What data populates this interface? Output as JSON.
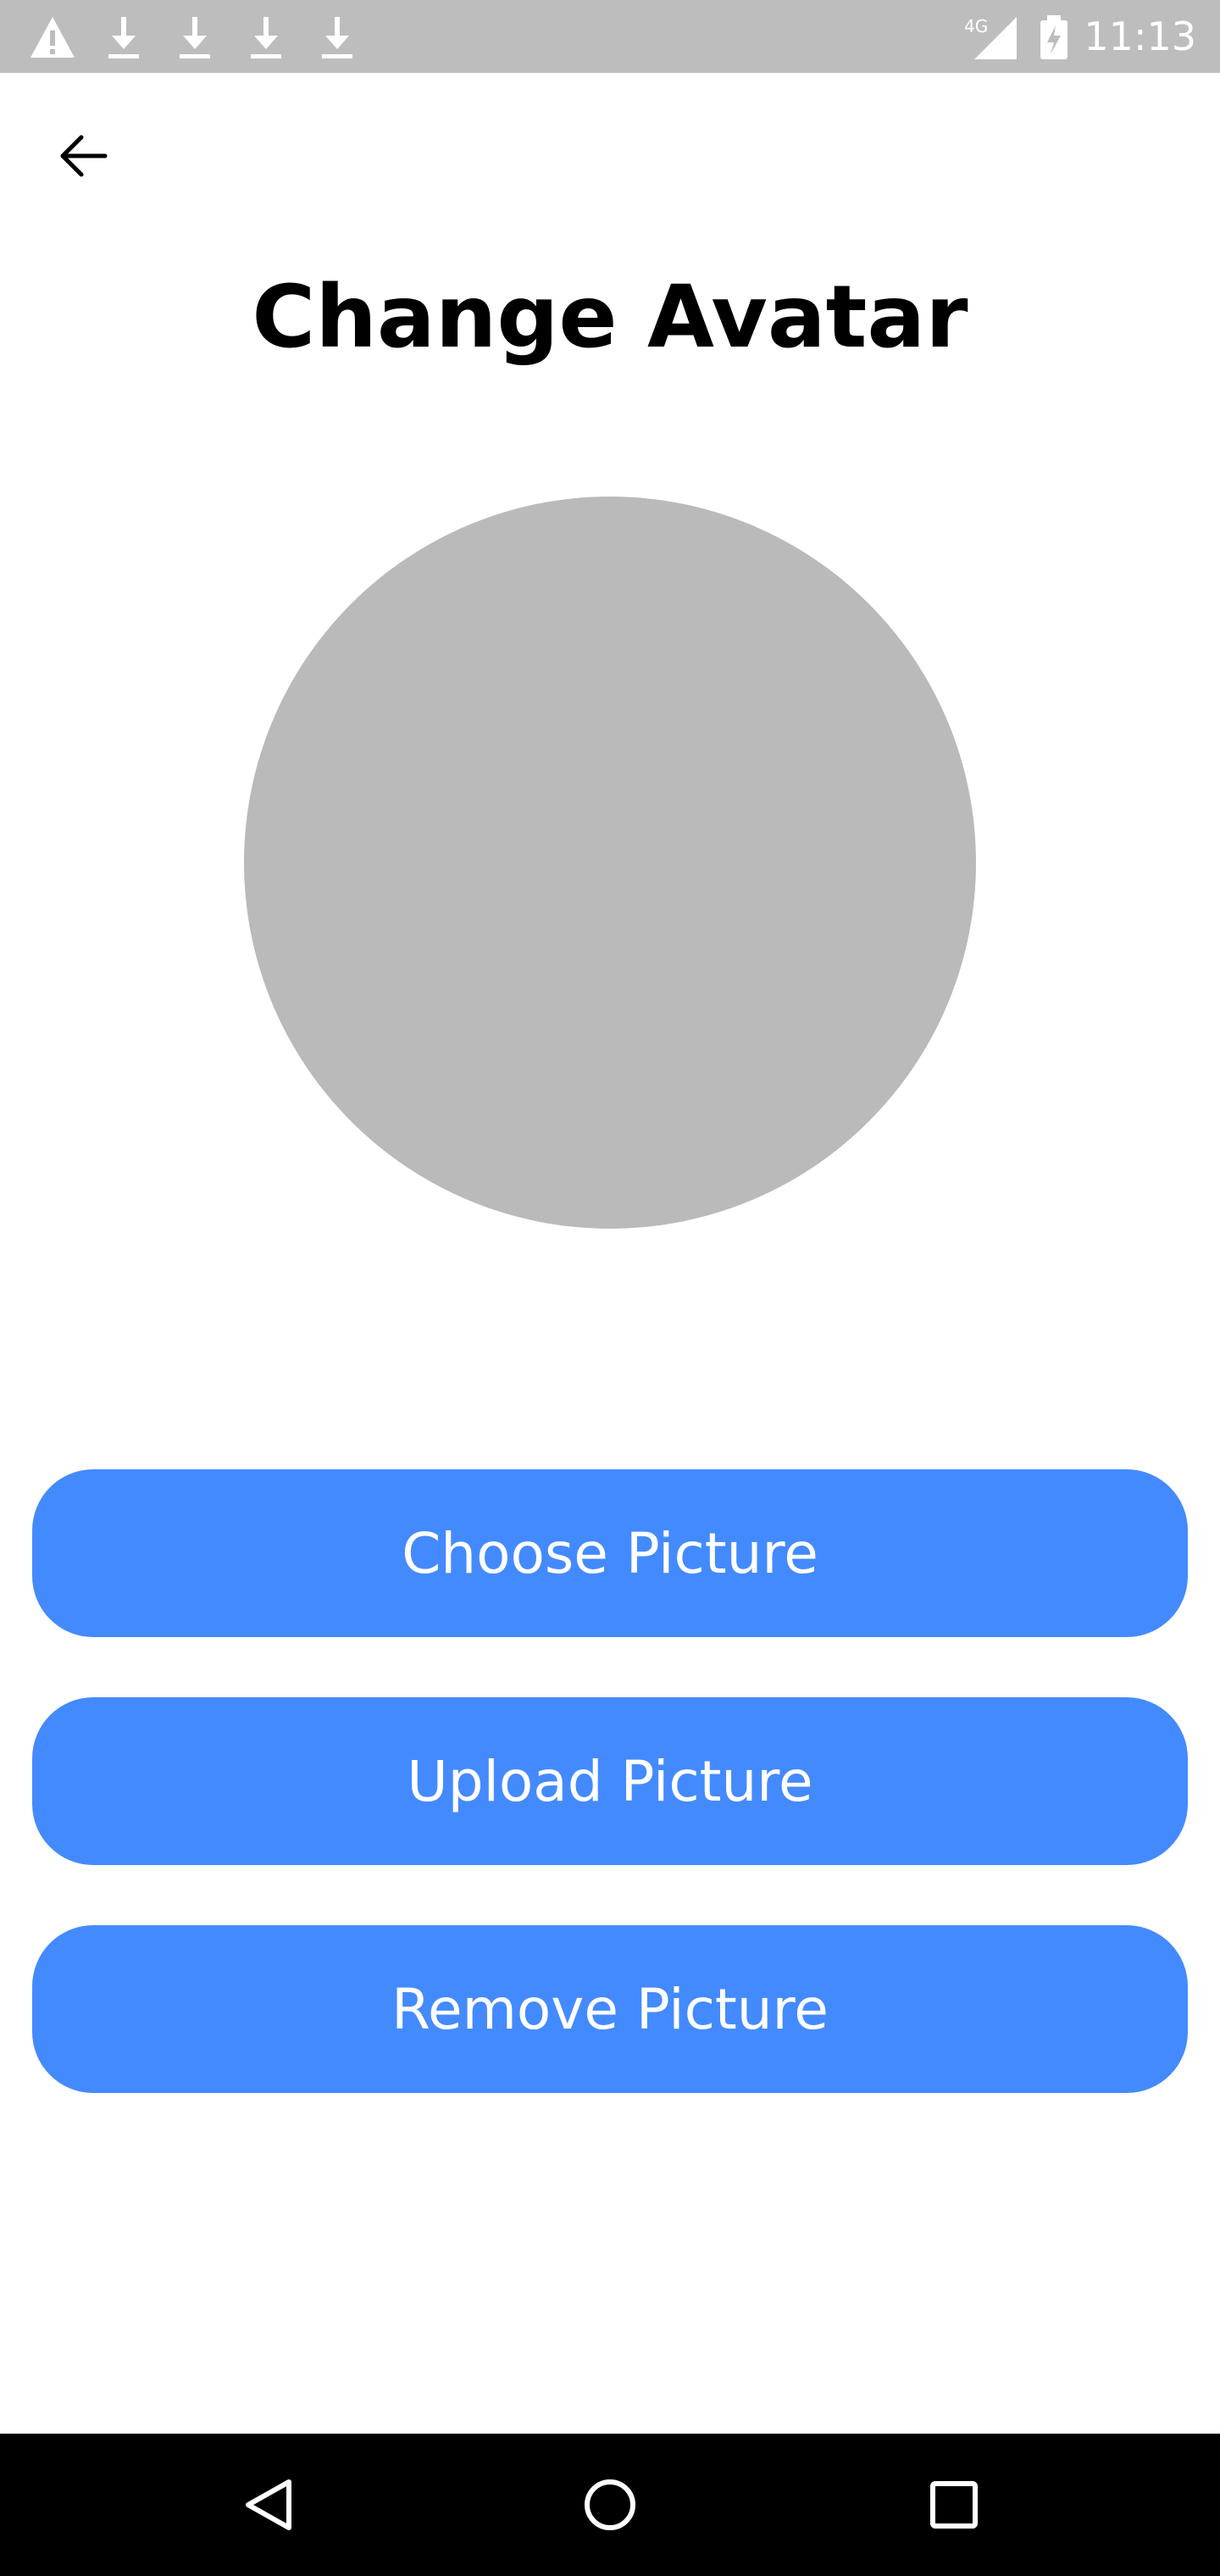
{
  "status_bar": {
    "time": "11:13",
    "network": "4G",
    "notification_icons": [
      "warning-icon",
      "download-icon",
      "download-icon",
      "download-icon",
      "download-icon"
    ],
    "background": "#bdbdbd"
  },
  "page": {
    "title": "Change Avatar",
    "back_icon": "arrow-left-icon"
  },
  "avatar": {
    "color": "#bababa"
  },
  "buttons": {
    "choose_label": "Choose Picture",
    "upload_label": "Upload Picture",
    "remove_label": "Remove Picture",
    "color": "#448aff"
  },
  "nav_bar": {
    "back_icon": "triangle-back-icon",
    "home_icon": "circle-home-icon",
    "recents_icon": "square-recents-icon"
  }
}
